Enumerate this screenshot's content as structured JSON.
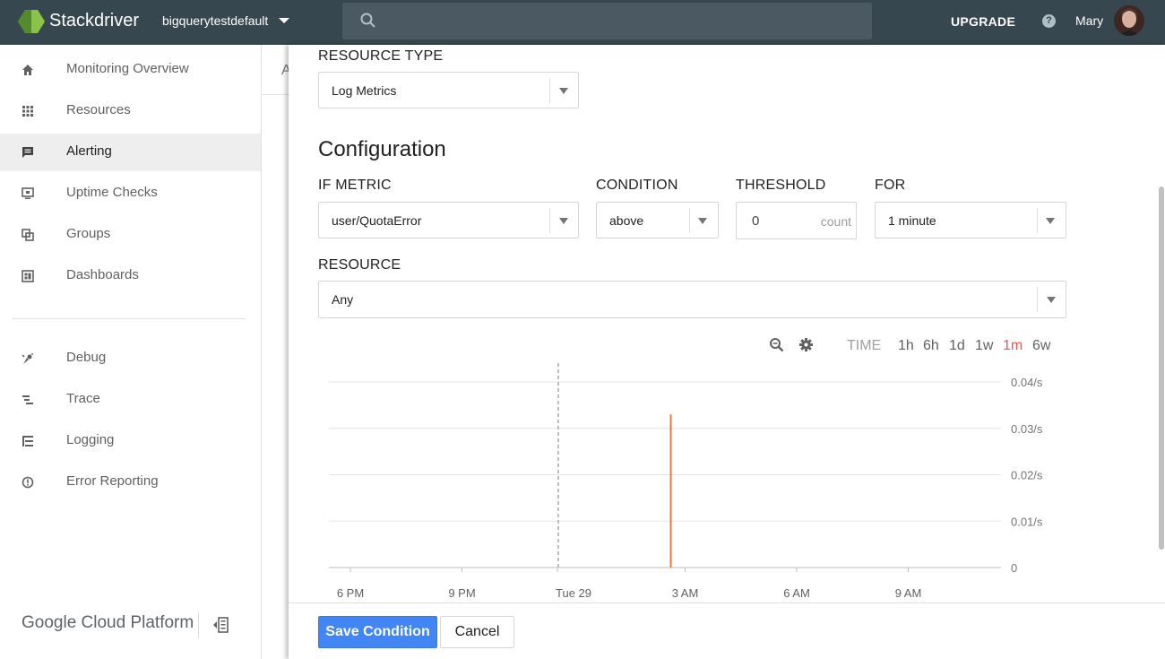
{
  "topbar": {
    "brand": "Stackdriver",
    "project": "bigquerytestdefault",
    "upgrade": "UPGRADE",
    "help_icon": "?",
    "user": "Mary"
  },
  "sidebar": {
    "items": [
      {
        "label": "Monitoring Overview",
        "icon": "home-icon"
      },
      {
        "label": "Resources",
        "icon": "grid-icon"
      },
      {
        "label": "Alerting",
        "icon": "alert-chat-icon",
        "active": true
      },
      {
        "label": "Uptime Checks",
        "icon": "monitor-icon"
      },
      {
        "label": "Groups",
        "icon": "groups-icon"
      },
      {
        "label": "Dashboards",
        "icon": "dashboard-icon"
      },
      {
        "label": "Debug",
        "icon": "debug-icon"
      },
      {
        "label": "Trace",
        "icon": "trace-icon"
      },
      {
        "label": "Logging",
        "icon": "logging-icon"
      },
      {
        "label": "Error Reporting",
        "icon": "error-reporting-icon"
      }
    ],
    "footer": "Google Cloud Platform"
  },
  "background_page": {
    "partial_text": "A"
  },
  "panel": {
    "resource_type": {
      "label": "RESOURCE TYPE",
      "value": "Log Metrics"
    },
    "section_title": "Configuration",
    "if_metric": {
      "label": "IF METRIC",
      "value": "user/QuotaError"
    },
    "condition": {
      "label": "CONDITION",
      "value": "above"
    },
    "threshold": {
      "label": "THRESHOLD",
      "value": "0",
      "unit": "count"
    },
    "for": {
      "label": "FOR",
      "value": "1 minute"
    },
    "resource": {
      "label": "RESOURCE",
      "value": "Any"
    },
    "time_label": "TIME",
    "ranges": [
      "1h",
      "6h",
      "1d",
      "1w",
      "1m",
      "6w"
    ],
    "active_range": "1m",
    "save_label": "Save Condition",
    "cancel_label": "Cancel"
  },
  "colors": {
    "topbar": "#37474f",
    "accent": "#4285f4",
    "series": "#ff7043",
    "active_range": "#ef5350"
  },
  "chart_data": {
    "type": "line",
    "x_tick_labels": [
      "6 PM",
      "9 PM",
      "Tue 29",
      "3 AM",
      "6 AM",
      "9 AM"
    ],
    "y_tick_labels": [
      "0.04/s",
      "0.03/s",
      "0.02/s",
      "0.01/s",
      "0"
    ],
    "ylim": [
      0,
      0.04
    ],
    "grid": true,
    "day_marker": "Tue 29",
    "series": [
      {
        "points": [
          {
            "x": "3 AM",
            "y": 0.033
          }
        ]
      }
    ]
  }
}
